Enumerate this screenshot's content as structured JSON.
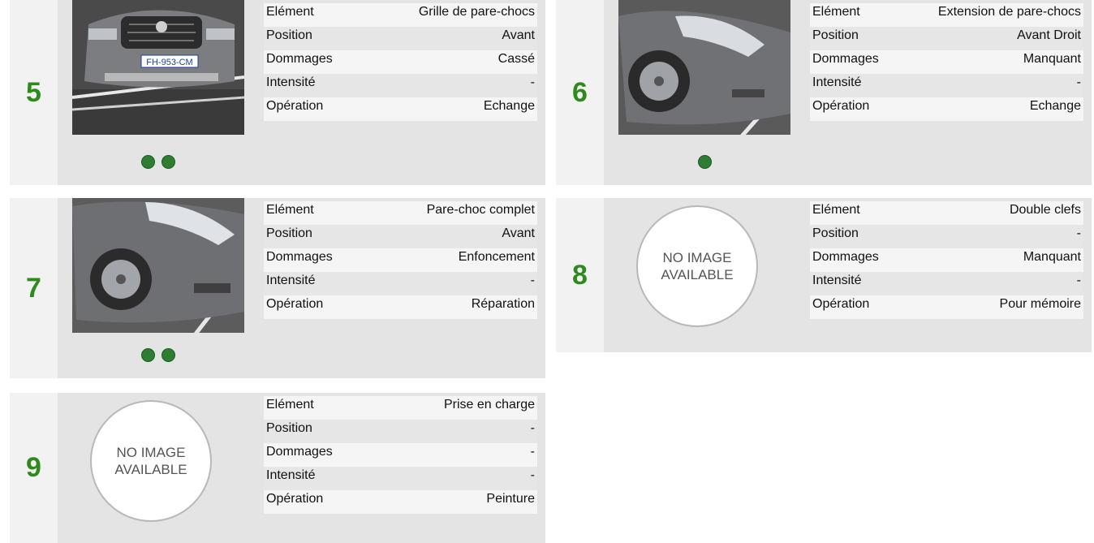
{
  "labels": {
    "element": "Elément",
    "position": "Position",
    "dommages": "Dommages",
    "intensite": "Intensité",
    "operation": "Opération"
  },
  "no_image_text": "NO IMAGE\nAVAILABLE",
  "items": [
    {
      "number": "5",
      "element": "Grille de pare-chocs",
      "position": "Avant",
      "dommages": "Cassé",
      "intensite": "-",
      "operation": "Echange",
      "photo_count": 2,
      "plate": "FH-953-CM"
    },
    {
      "number": "6",
      "element": "Extension de pare-chocs",
      "position": "Avant Droit",
      "dommages": "Manquant",
      "intensite": "-",
      "operation": "Echange",
      "photo_count": 1
    },
    {
      "number": "7",
      "element": "Pare-choc complet",
      "position": "Avant",
      "dommages": "Enfoncement",
      "intensite": "-",
      "operation": "Réparation",
      "photo_count": 2
    },
    {
      "number": "8",
      "element": "Double clefs",
      "position": "-",
      "dommages": "Manquant",
      "intensite": "-",
      "operation": "Pour mémoire",
      "photo_count": 0
    },
    {
      "number": "9",
      "element": "Prise en charge",
      "position": "-",
      "dommages": "-",
      "intensite": "-",
      "operation": "Peinture",
      "photo_count": 0
    }
  ],
  "colors": {
    "number": "#2f8a1e",
    "dot": "#2e7d32",
    "card_bg": "#e4e4e4"
  }
}
